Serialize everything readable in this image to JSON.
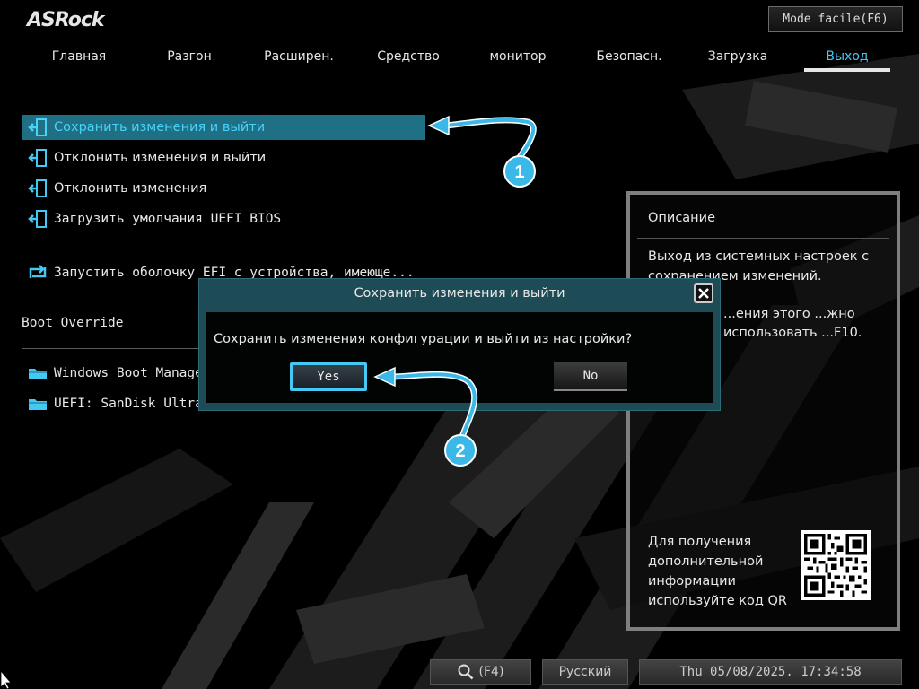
{
  "brand": {
    "logo": "ASRock"
  },
  "header": {
    "mode_button": "Mode facile(F6)"
  },
  "tabs": [
    {
      "label": "Главная"
    },
    {
      "label": "Разгон"
    },
    {
      "label": "Расширен."
    },
    {
      "label": "Средство"
    },
    {
      "label": "монитор"
    },
    {
      "label": "Безопасн."
    },
    {
      "label": "Загрузка"
    },
    {
      "label": "Выход",
      "active": true
    }
  ],
  "menu": {
    "items": [
      {
        "label": "Сохранить изменения и выйти",
        "icon": "exit-door-icon",
        "selected": true
      },
      {
        "label": "Отклонить изменения и выйти",
        "icon": "exit-door-icon"
      },
      {
        "label": "Отклонить изменения",
        "icon": "exit-door-icon"
      },
      {
        "label": "Загрузить умолчания UEFI BIOS",
        "icon": "exit-door-icon"
      },
      {
        "label": "Запустить оболочку EFI с устройства, имеюще...",
        "icon": "shell-loop-icon"
      }
    ],
    "boot_override_title": "Boot Override",
    "boot_items": [
      {
        "label": "Windows Boot Manager",
        "icon": "folder-icon"
      },
      {
        "label": "UEFI: SanDisk Ultra",
        "icon": "folder-icon"
      }
    ]
  },
  "description": {
    "title": "Описание",
    "text": "Выход из системных настроек с сохранением изменений.",
    "text_partial": "...ения этого ...жно использовать ...F10.",
    "qr_text": "Для получения дополнительной информации используйте код QR"
  },
  "dialog": {
    "title": "Сохранить изменения и выйти",
    "message": "Сохранить изменения конфигурации и выйти из настройки?",
    "yes_label": "Yes",
    "no_label": "No"
  },
  "bottom_bar": {
    "search_label": "(F4)",
    "language": "Русский",
    "datetime": "Thu 05/08/2025. 17:34:58"
  },
  "annotations": [
    {
      "number": "1"
    },
    {
      "number": "2"
    }
  ],
  "colors": {
    "accent": "#45c8f2",
    "selected_row": "#1f6f85",
    "dialog_bg": "#1d4c56",
    "annotation": "#3ab8e8"
  }
}
